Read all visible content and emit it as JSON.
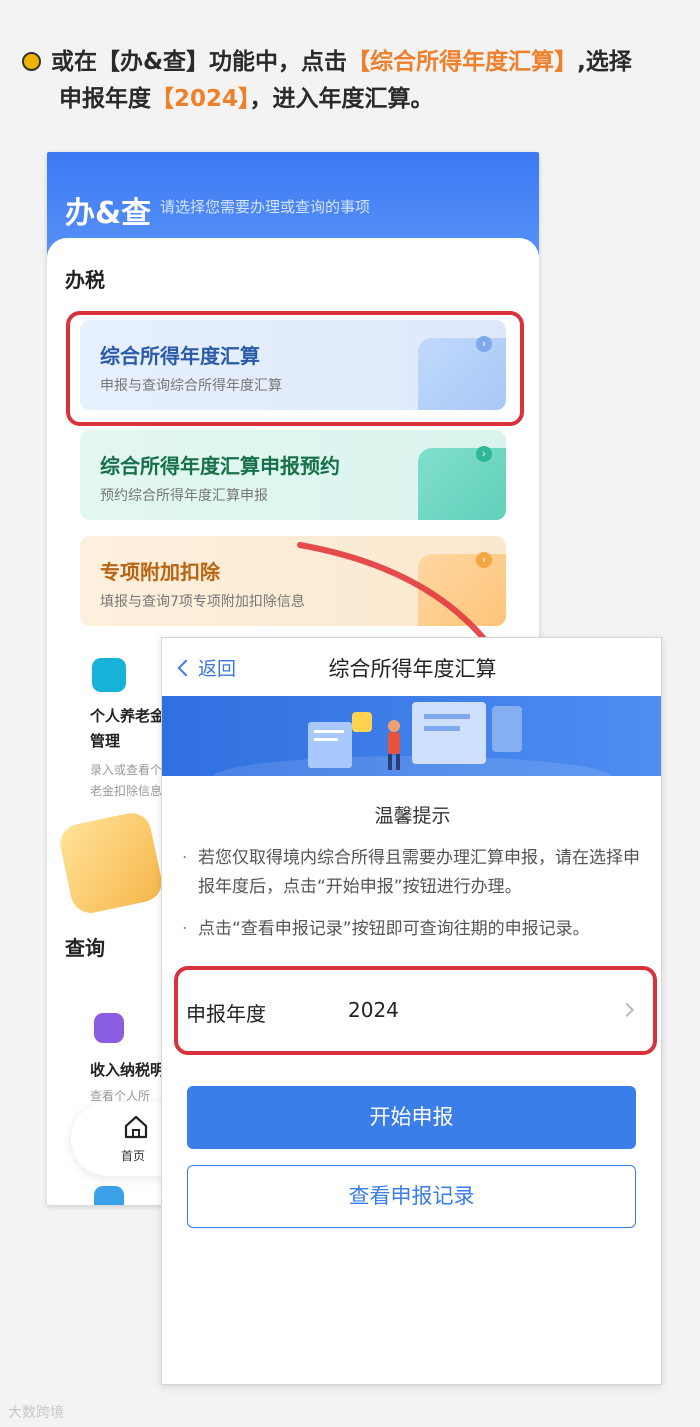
{
  "instruction": {
    "part1": "或在【办&查】功能中，点击",
    "highlight1": "【综合所得年度汇算】",
    "part2": ",选择",
    "part3": "申报年度",
    "highlight2": "【2024】",
    "part4": "，进入年度汇算。"
  },
  "back_screen": {
    "header_title": "办&查",
    "header_subtitle": "请选择您需要办理或查询的事项",
    "section_tax": "办税",
    "cards": [
      {
        "title": "综合所得年度汇算",
        "subtitle": "申报与查询综合所得年度汇算"
      },
      {
        "title": "综合所得年度汇算申报预约",
        "subtitle": "预约综合所得年度汇算申报"
      },
      {
        "title": "专项附加扣除",
        "subtitle": "填报与查询7项专项附加扣除信息"
      }
    ],
    "pension_tile": {
      "title_line1": "个人养老金",
      "title_line2": "管理",
      "sub_line1": "录入或查看个",
      "sub_line2": "老金扣除信息"
    },
    "section_query": "查询",
    "income_tile": {
      "title": "收入纳税明",
      "sub": "查看个人所"
    },
    "tab_home": "首页"
  },
  "front_screen": {
    "nav_back": "返回",
    "nav_title": "综合所得年度汇算",
    "tips_title": "温馨提示",
    "tip1": "若您仅取得境内综合所得且需要办理汇算申报，请在选择申报年度后，点击“开始申报”按钮进行办理。",
    "tip2": "点击“查看申报记录”按钮即可查询往期的申报记录。",
    "year_label": "申报年度",
    "year_value": "2024",
    "start_button": "开始申报",
    "records_button": "查看申报记录"
  },
  "watermark": "大数跨境",
  "colors": {
    "accent": "#3b7de9",
    "highlight": "#f07f2a",
    "annotation_red": "#d9323b",
    "bullet": "#f0b400"
  }
}
